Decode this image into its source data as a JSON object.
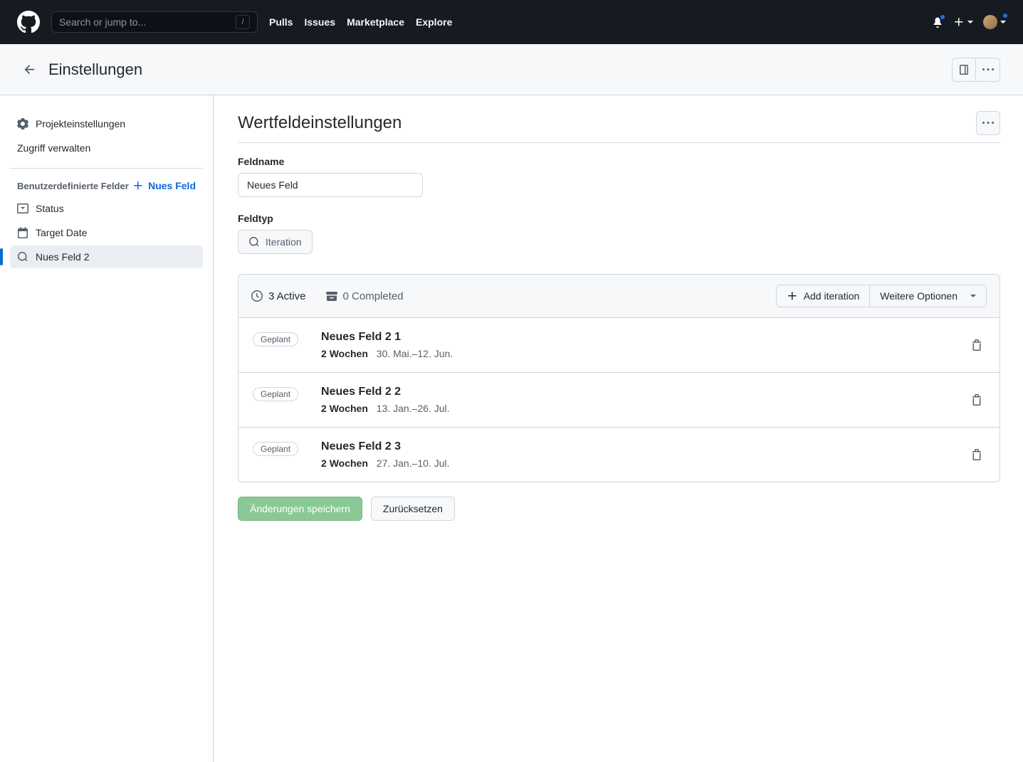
{
  "topnav": {
    "search_placeholder": "Search or jump to...",
    "links": [
      "Pulls",
      "Issues",
      "Marketplace",
      "Explore"
    ]
  },
  "subheader": {
    "title": "Einstellungen"
  },
  "sidebar": {
    "project_settings": "Projekteinstellungen",
    "manage_access": "Zugriff verwalten",
    "custom_fields_header": "Benutzerdefinierte Felder",
    "new_field_label": "Nues Feld",
    "fields": [
      {
        "label": "Status"
      },
      {
        "label": "Target Date"
      },
      {
        "label": "Nues Feld 2"
      }
    ]
  },
  "main": {
    "title": "Wertfeldeinstellungen",
    "fieldname_label": "Feldname",
    "fieldname_value": "Neues Feld",
    "fieldtype_label": "Feldtyp",
    "fieldtype_value": "Iteration",
    "active_count": "3 Active",
    "completed_count": "0 Completed",
    "add_iteration_label": "Add iteration",
    "more_options_label": "Weitere Optionen",
    "planned_badge": "Geplant",
    "iterations": [
      {
        "name": "Neues Feld 2 1",
        "duration": "2 Wochen",
        "range": "30. Mai.–12. Jun."
      },
      {
        "name": "Neues Feld 2 2",
        "duration": "2 Wochen",
        "range": "13. Jan.–26. Jul."
      },
      {
        "name": "Neues Feld 2 3",
        "duration": "2 Wochen",
        "range": "27. Jan.–10. Jul."
      }
    ],
    "save_label": "Änderungen speichern",
    "reset_label": "Zurücksetzen"
  }
}
